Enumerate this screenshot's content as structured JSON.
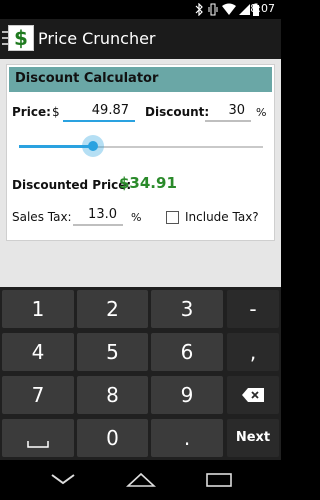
{
  "statusbar": {
    "time": "8:07",
    "icons": [
      "bluetooth-icon",
      "vibrate-icon",
      "wifi-icon",
      "signal-icon",
      "battery-icon"
    ]
  },
  "actionbar": {
    "title": "Price Cruncher",
    "logo_icon": "app-logo-icon"
  },
  "calculator": {
    "header": "Discount Calculator",
    "price_label": "Price:",
    "currency": "$",
    "price_value": "49.87",
    "discount_label": "Discount:",
    "discount_value": "30",
    "percent": "%",
    "slider_value_percent": 30,
    "discounted_label": "Discounted Price:",
    "discounted_value": "$34.91",
    "tax_label": "Sales Tax:",
    "tax_value": "13.0",
    "tax_percent": "%",
    "include_tax_label": "Include Tax?",
    "include_tax_checked": false
  },
  "keyboard": {
    "row1": [
      "1",
      "2",
      "3",
      "-"
    ],
    "row2": [
      "4",
      "5",
      "6",
      ","
    ],
    "row3": [
      "7",
      "8",
      "9"
    ],
    "row4": [
      "0",
      "."
    ],
    "next": "Next"
  },
  "navbar": {
    "icons": [
      "back-icon",
      "home-icon",
      "recents-icon"
    ]
  },
  "colors": {
    "header_bg": "#6aa7a6",
    "accent": "#2aa2e0",
    "result": "#2a8a2a"
  }
}
